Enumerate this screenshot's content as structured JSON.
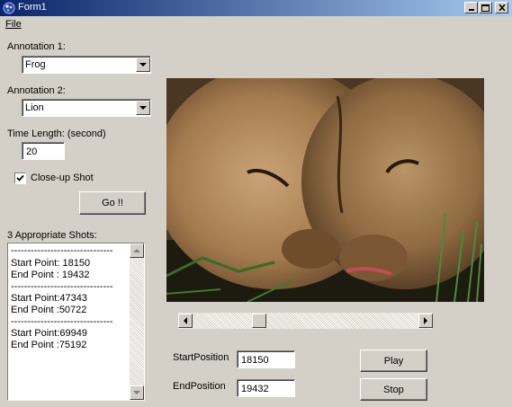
{
  "window": {
    "title": "Form1"
  },
  "menu": {
    "file": "File"
  },
  "annotation1": {
    "label": "Annotation 1:",
    "value": "Frog"
  },
  "annotation2": {
    "label": "Annotation 2:",
    "value": "Lion"
  },
  "time_length": {
    "label": "Time Length: (second)",
    "value": "20"
  },
  "closeup": {
    "label": "Close-up Shot",
    "checked": true
  },
  "go_button": "Go !!",
  "shots": {
    "label": "3 Appropriate Shots:",
    "lines": [
      "-------------------------------",
      "Start Point: 18150",
      "End Point : 19432",
      "-------------------------------",
      "Start Point:47343",
      "End Point :50722",
      "-------------------------------",
      "Start Point:69949",
      "End Point :75192"
    ]
  },
  "playback": {
    "start_label": "StartPosition",
    "start_value": "18150",
    "end_label": "EndPosition",
    "end_value": "19432",
    "play": "Play",
    "stop": "Stop",
    "scroll_position": 0.28
  },
  "icons": [
    "app-icon",
    "minimize-icon",
    "maximize-icon",
    "close-icon",
    "dropdown-arrow-icon",
    "check-icon",
    "scroll-up-icon",
    "scroll-down-icon",
    "scroll-left-icon",
    "scroll-right-icon"
  ],
  "colors": {
    "titlebar_start": "#0a246a",
    "titlebar_end": "#a6caf0",
    "face": "#d4d0c8"
  }
}
